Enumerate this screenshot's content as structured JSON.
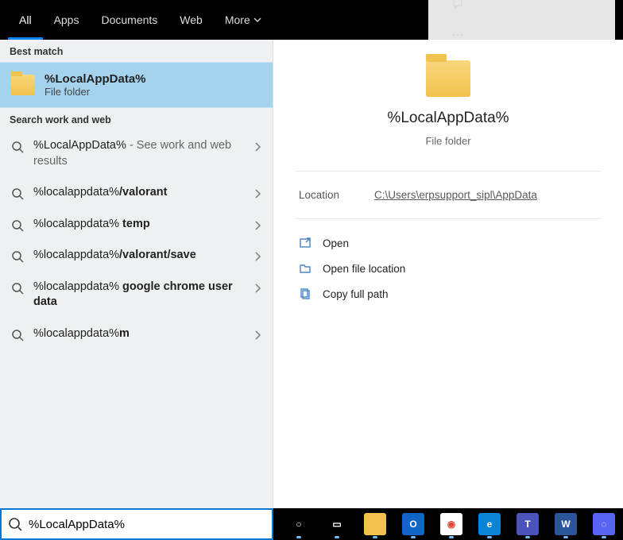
{
  "tabs": [
    "All",
    "Apps",
    "Documents",
    "Web",
    "More"
  ],
  "activeTab": 0,
  "sections": {
    "best": "Best match",
    "work": "Search work and web"
  },
  "bestMatch": {
    "title": "%LocalAppData%",
    "subtitle": "File folder"
  },
  "suggestions": [
    {
      "prefix": "%LocalAppData%",
      "bold": "",
      "suffix": " - See work and web results"
    },
    {
      "prefix": "%localappdata%",
      "bold": "/valorant",
      "suffix": ""
    },
    {
      "prefix": "%localappdata%",
      "bold": " temp",
      "suffix": ""
    },
    {
      "prefix": "%localappdata%",
      "bold": "/valorant/save",
      "suffix": ""
    },
    {
      "prefix": "%localappdata%",
      "bold": " google chrome user data",
      "suffix": ""
    },
    {
      "prefix": "%localappdata%",
      "bold": "m",
      "suffix": ""
    }
  ],
  "preview": {
    "title": "%LocalAppData%",
    "subtitle": "File folder",
    "locationLabel": "Location",
    "locationPath": "C:\\Users\\erpsupport_sipl\\AppData",
    "actions": [
      "Open",
      "Open file location",
      "Copy full path"
    ]
  },
  "search": {
    "value": "%LocalAppData%"
  },
  "taskbar": {
    "apps": [
      {
        "name": "cortana",
        "bg": "#000",
        "glyph": "○",
        "glyphC": "#fff"
      },
      {
        "name": "task-view",
        "bg": "#000",
        "glyph": "▭",
        "glyphC": "#fff"
      },
      {
        "name": "file-explorer",
        "bg": "#f1c34e",
        "glyph": "",
        "glyphC": "#000"
      },
      {
        "name": "outlook",
        "bg": "#1066c6",
        "glyph": "O",
        "glyphC": "#fff"
      },
      {
        "name": "chrome",
        "bg": "#fff",
        "glyph": "◉",
        "glyphC": "#dd4b39"
      },
      {
        "name": "edge",
        "bg": "#0a84d6",
        "glyph": "e",
        "glyphC": "#fff"
      },
      {
        "name": "teams",
        "bg": "#4b53bc",
        "glyph": "T",
        "glyphC": "#fff"
      },
      {
        "name": "word",
        "bg": "#2b579a",
        "glyph": "W",
        "glyphC": "#fff"
      },
      {
        "name": "discord",
        "bg": "#5865f2",
        "glyph": "◌",
        "glyphC": "#fff"
      }
    ]
  }
}
